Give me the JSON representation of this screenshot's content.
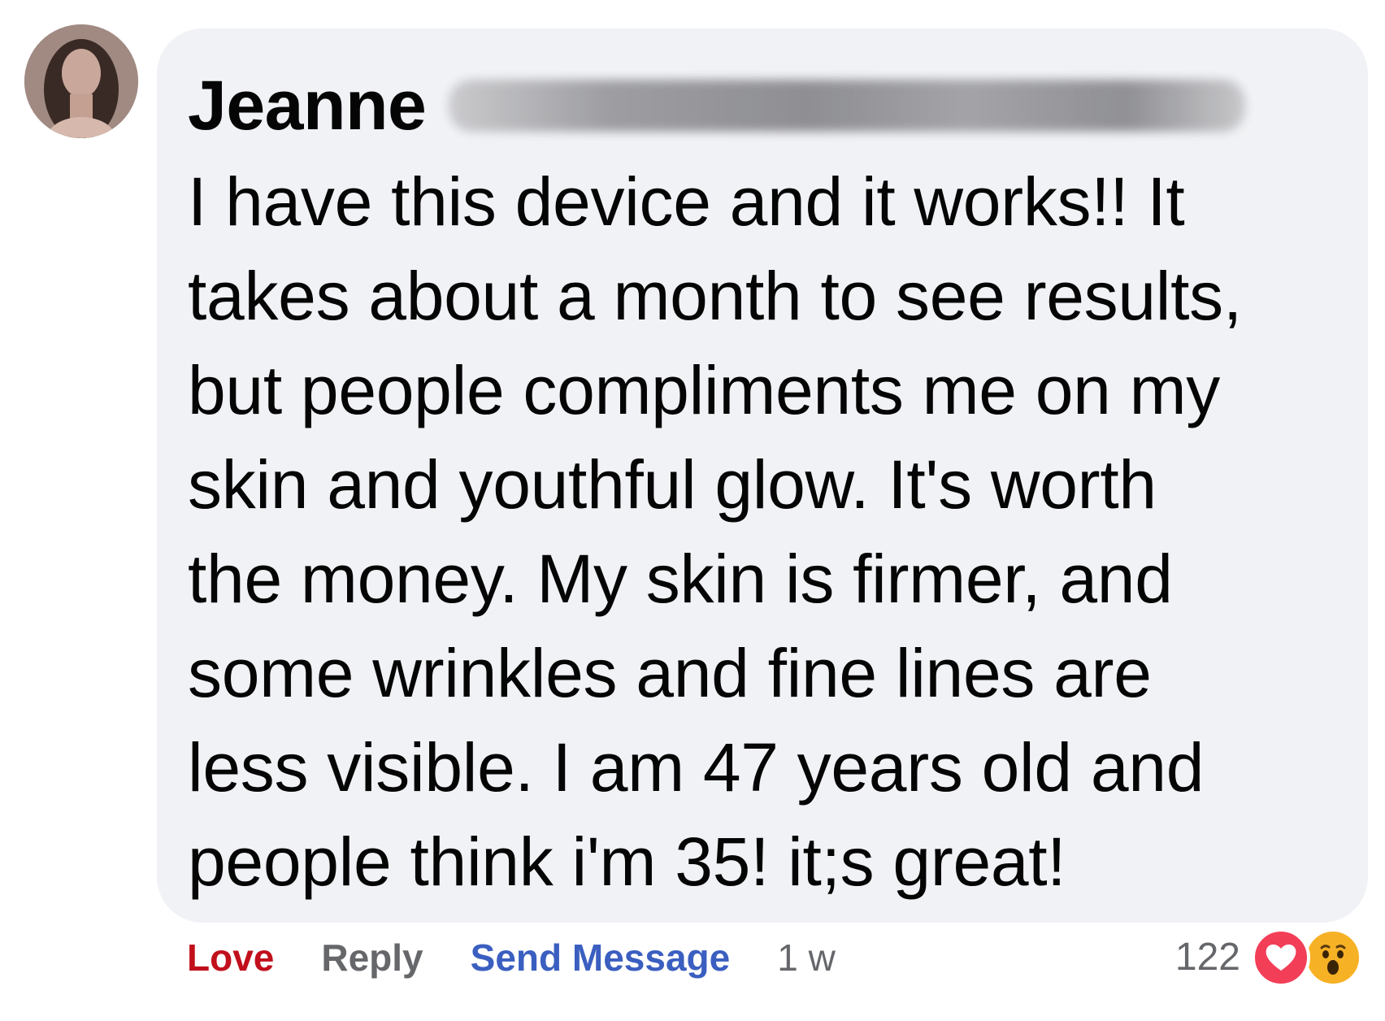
{
  "comment": {
    "author_first_name": "Jeanne",
    "lines": [
      "I have this device and it works!! It",
      "takes about a month to see results,",
      "but people compliments me on my",
      "skin and youthful glow. It's worth",
      "the money. My skin is firmer, and",
      "some wrinkles and fine lines are",
      "less visible. I am 47 years old and",
      "people think i'm 35! it;s great!"
    ]
  },
  "actions": {
    "love_label": "Love",
    "reply_label": "Reply",
    "send_message_label": "Send Message",
    "timestamp": "1 w"
  },
  "reactions": {
    "count": "122",
    "icons": [
      "heart-icon",
      "wow-icon"
    ]
  },
  "colors": {
    "bubble_background": "#f0f2f5",
    "love": "#c10f1c",
    "link": "#3b5fc0",
    "muted": "#65676b",
    "heart": "#f33e58",
    "wow": "#f7b125"
  }
}
